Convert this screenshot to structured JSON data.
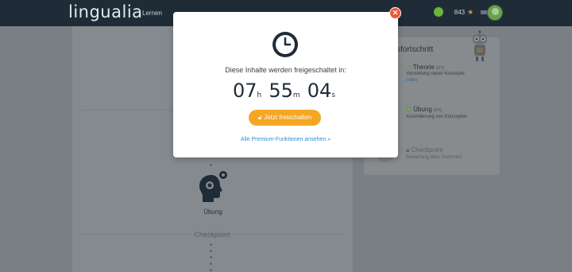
{
  "navbar": {
    "logo": "lingualia",
    "learn": "Lernen",
    "score": "843",
    "level": "B1"
  },
  "main": {
    "step_label": "Übung",
    "checkpoint_label": "Checkpoint"
  },
  "side": {
    "title": "onsfortschritt",
    "items": [
      {
        "label": "Theorie",
        "tag": "[0/7]",
        "sub": "Vorstellung neuer Konzepte",
        "link": "index"
      },
      {
        "label": "Übung",
        "tag": "[0%]",
        "sub": "Assimilierung von Konzepten"
      },
      {
        "label": "Checkpoint",
        "sub": "Bewertung alles Gelernten"
      }
    ]
  },
  "modal": {
    "message": "Diese Inhalte werden freigeschaltet in:",
    "hours": "07",
    "hours_unit": "h",
    "minutes": "55",
    "minutes_unit": "m",
    "seconds": "04",
    "seconds_unit": "s",
    "unlock_button": "Jetzt freischalten",
    "premium_link": "Alle Premium-Funktionen ansehen »"
  },
  "colors": {
    "navbar": "#1f2c38",
    "accent_orange": "#f5a623",
    "close_red": "#e8593a",
    "link_blue": "#2b8fd6",
    "success_green": "#5da23b"
  },
  "icons": [
    "clock-icon",
    "close-icon",
    "unlock-icon",
    "head-gear-icon",
    "robot-icon",
    "star-icon",
    "flag-icon",
    "coin-icon",
    "lock-icon",
    "check-icon"
  ]
}
